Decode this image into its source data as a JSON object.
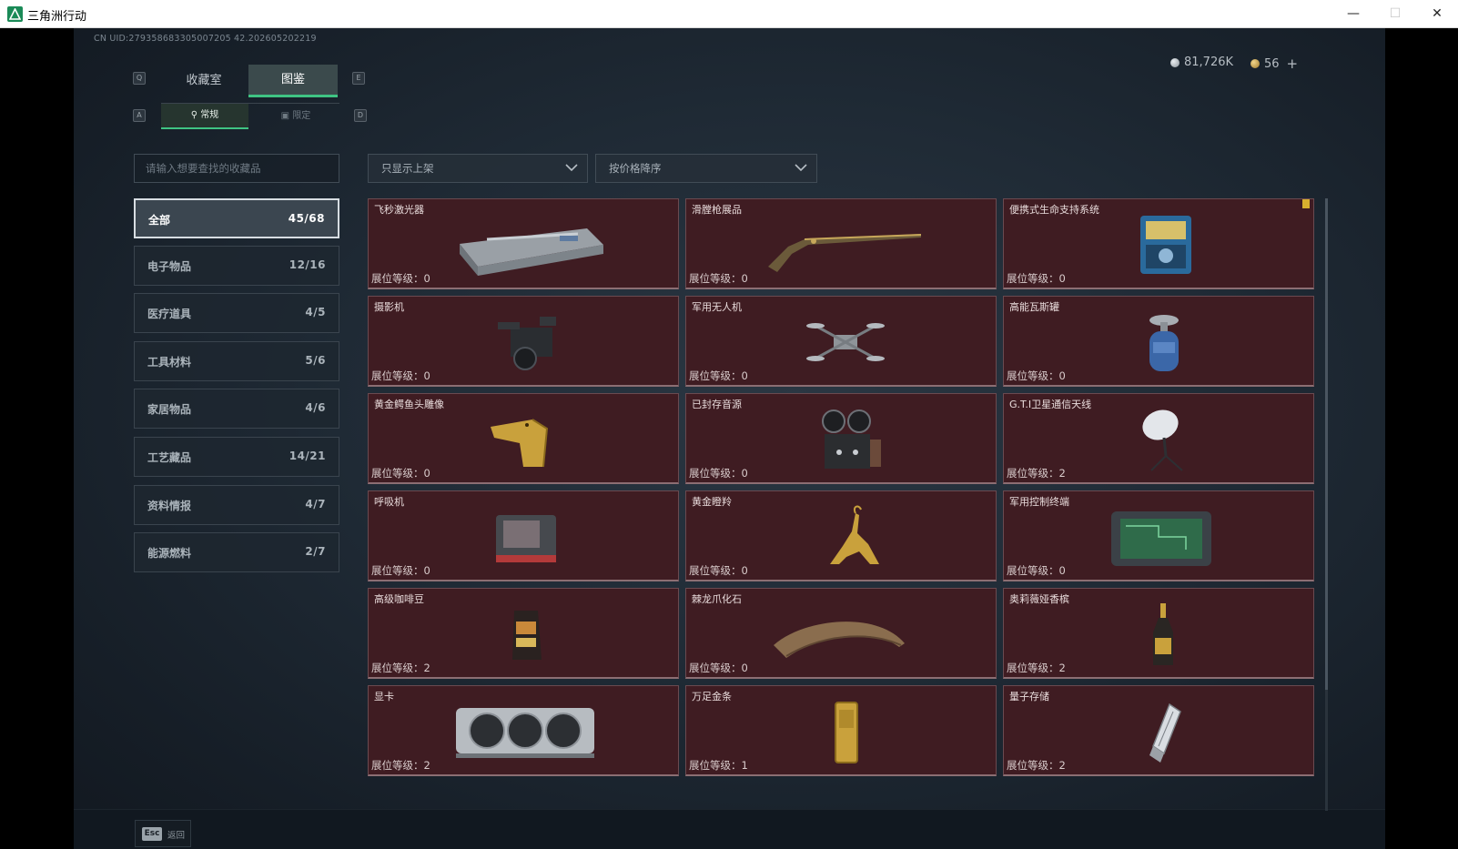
{
  "window": {
    "title": "三角洲行动",
    "minimize": "—",
    "maximize": "☐",
    "close": "✕"
  },
  "uid": "CN UID:279358683305007205 42.202605202219",
  "currency": {
    "silver": "81,726K",
    "gold": "56",
    "add": "+"
  },
  "keys": {
    "prev_tab": "Q",
    "next_tab": "E",
    "prev_sub": "A",
    "next_sub": "D"
  },
  "tabs": [
    {
      "label": "收藏室",
      "active": false
    },
    {
      "label": "图鉴",
      "active": true
    }
  ],
  "subtabs": [
    {
      "label": "常规",
      "active": true
    },
    {
      "label": "限定",
      "active": false
    }
  ],
  "search": {
    "placeholder": "请输入想要查找的收藏品"
  },
  "filters": {
    "shelf": "只显示上架",
    "sort": "按价格降序"
  },
  "categories": [
    {
      "name": "全部",
      "count": "45/68",
      "active": true
    },
    {
      "name": "电子物品",
      "count": "12/16",
      "active": false
    },
    {
      "name": "医疗道具",
      "count": "4/5",
      "active": false
    },
    {
      "name": "工具材料",
      "count": "5/6",
      "active": false
    },
    {
      "name": "家居物品",
      "count": "4/6",
      "active": false
    },
    {
      "name": "工艺藏品",
      "count": "14/21",
      "active": false
    },
    {
      "name": "资料情报",
      "count": "4/7",
      "active": false
    },
    {
      "name": "能源燃料",
      "count": "2/7",
      "active": false
    }
  ],
  "level_label": "展位等级：",
  "items": [
    {
      "name": "飞秒激光器",
      "level": "0",
      "icon": "laser-case-icon"
    },
    {
      "name": "滑膛枪展品",
      "level": "0",
      "icon": "musket-icon"
    },
    {
      "name": "便携式生命支持系统",
      "level": "0",
      "icon": "life-support-icon",
      "flag": true
    },
    {
      "name": "摄影机",
      "level": "0",
      "icon": "camera-icon"
    },
    {
      "name": "军用无人机",
      "level": "0",
      "icon": "drone-icon"
    },
    {
      "name": "高能瓦斯罐",
      "level": "0",
      "icon": "gas-tank-icon"
    },
    {
      "name": "黄金鳄鱼头雕像",
      "level": "0",
      "icon": "gold-croc-icon"
    },
    {
      "name": "已封存音源",
      "level": "0",
      "icon": "reel-recorder-icon"
    },
    {
      "name": "G.T.I卫星通信天线",
      "level": "2",
      "icon": "satellite-dish-icon"
    },
    {
      "name": "呼吸机",
      "level": "0",
      "icon": "ventilator-icon"
    },
    {
      "name": "黄金瞪羚",
      "level": "0",
      "icon": "gold-gazelle-icon"
    },
    {
      "name": "军用控制终端",
      "level": "0",
      "icon": "control-terminal-icon"
    },
    {
      "name": "高级咖啡豆",
      "level": "2",
      "icon": "coffee-bag-icon"
    },
    {
      "name": "棘龙爪化石",
      "level": "0",
      "icon": "claw-fossil-icon"
    },
    {
      "name": "奥莉薇娅香槟",
      "level": "2",
      "icon": "champagne-icon"
    },
    {
      "name": "显卡",
      "level": "2",
      "icon": "gpu-icon"
    },
    {
      "name": "万足金条",
      "level": "1",
      "icon": "gold-bar-icon"
    },
    {
      "name": "量子存储",
      "level": "2",
      "icon": "quantum-storage-icon"
    }
  ],
  "footer": {
    "esc_key": "Esc",
    "back": "返回"
  }
}
